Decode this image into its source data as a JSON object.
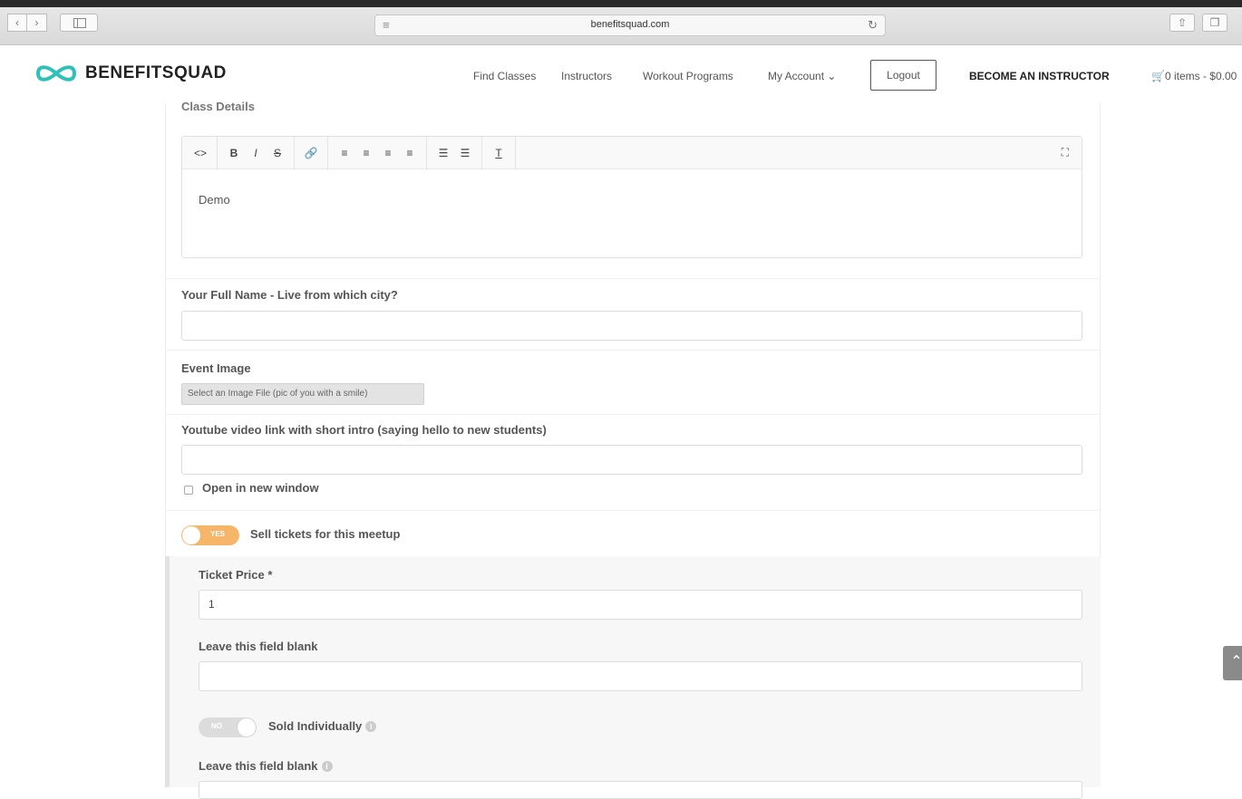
{
  "browser": {
    "url": "benefitsquad.com",
    "back_icon": "chevron-left-icon",
    "forward_icon": "chevron-right-icon"
  },
  "header": {
    "brand": "BENEFITSQUAD",
    "brand_color": "#2fc1b8",
    "nav": {
      "find_classes": "Find Classes",
      "instructors": "Instructors",
      "workout_programs": "Workout Programs",
      "my_account": "My Account ⌄"
    },
    "logout": "Logout",
    "become_instructor": "BECOME AN INSTRUCTOR",
    "cart": "0 items - $0.00"
  },
  "form": {
    "section_title": "Class Details",
    "editor": {
      "toolbar": {
        "code": "<>",
        "bold": "B",
        "italic": "I",
        "strike": "S",
        "link": "🔗",
        "align_left": "≡",
        "align_center": "≡",
        "align_right": "≡",
        "justify": "≡",
        "bullet_list": "☰",
        "numbered_list": "☰",
        "clear_format": "T",
        "fullscreen": "⛶"
      },
      "content": "Demo"
    },
    "full_name": {
      "label": "Your Full Name - Live from which city?",
      "value": ""
    },
    "event_image": {
      "label": "Event Image",
      "button": "Select an Image File (pic of you with a smile)"
    },
    "youtube": {
      "label": "Youtube video link with short intro (saying hello to new students)",
      "value": ""
    },
    "open_new_window": {
      "label": "Open in new window",
      "checked": false
    },
    "sell_tickets": {
      "toggle": "YES",
      "label": "Sell tickets for this meetup",
      "on": true,
      "color": "#f5b66a"
    },
    "ticket_price": {
      "label": "Ticket Price *",
      "value": "1"
    },
    "leave_blank_1": {
      "label": "Leave this field blank",
      "value": ""
    },
    "sold_individually": {
      "toggle": "NO",
      "label": "Sold Individually",
      "on": false
    },
    "leave_blank_2": {
      "label": "Leave this field blank"
    }
  }
}
